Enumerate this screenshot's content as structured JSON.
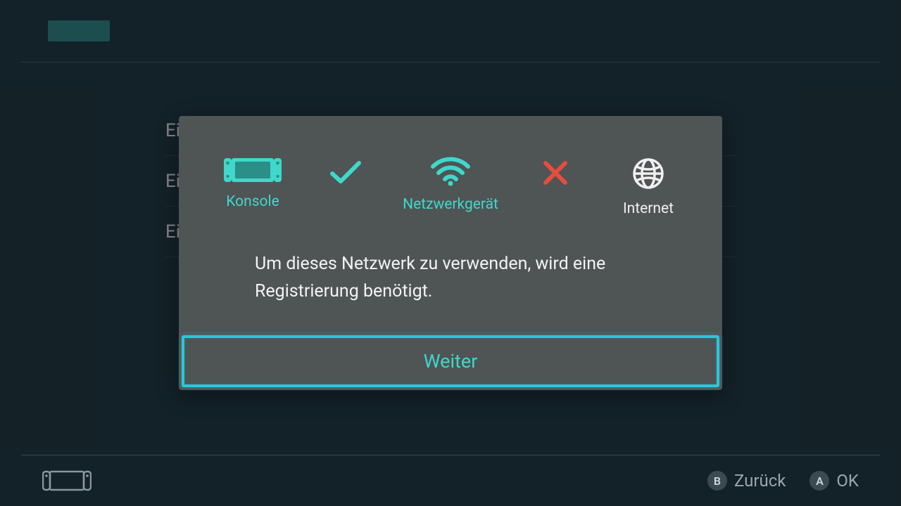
{
  "background": {
    "list_items": [
      "Eine Verbindung zu diesem Netzwerk herstellen",
      "Ei",
      "Ei"
    ]
  },
  "modal": {
    "status": {
      "console": {
        "label": "Konsole"
      },
      "network_device": {
        "label": "Netzwerkgerät"
      },
      "internet": {
        "label": "Internet"
      },
      "link1": "ok",
      "link2": "fail"
    },
    "message": "Um dieses Netzwerk zu verwenden, wird eine Registrierung benötigt.",
    "primary_button": "Weiter"
  },
  "footer": {
    "back_glyph": "B",
    "back_label": "Zurück",
    "ok_glyph": "A",
    "ok_label": "OK"
  },
  "colors": {
    "teal": "#3fd8cb",
    "red": "#e74c3c",
    "highlight_border": "#29c8d8"
  }
}
